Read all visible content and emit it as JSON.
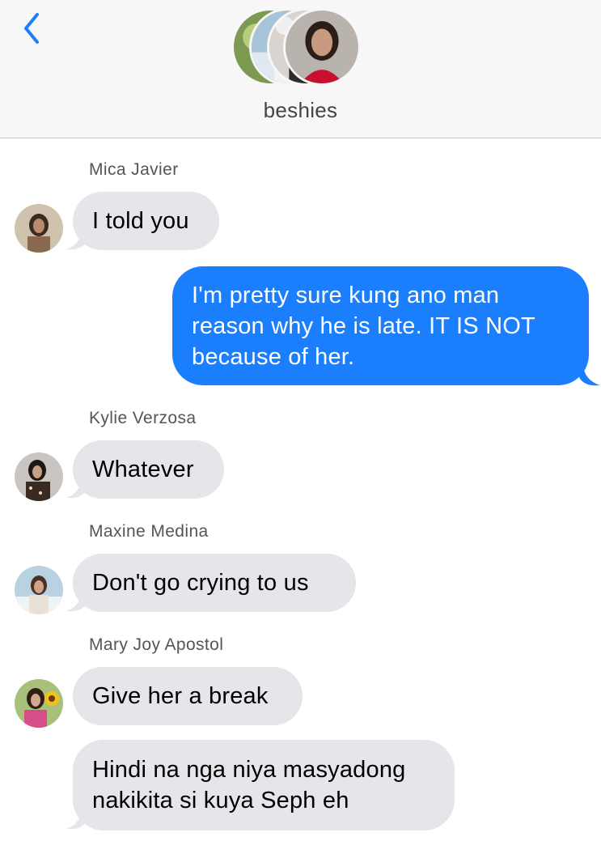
{
  "header": {
    "group_name": "beshies",
    "back_icon": "chevron-left-icon",
    "accent_color": "#1b7efc"
  },
  "messages": [
    {
      "sender": "Mica Javier",
      "text": "I told you",
      "direction": "incoming"
    },
    {
      "text": "I'm pretty sure kung ano man reason why he is late. IT IS NOT because of her.",
      "line1": "I'm pretty sure kung ano man",
      "line2": "reason why he is late. IT IS NOT",
      "line3": "because of her.",
      "direction": "outgoing"
    },
    {
      "sender": "Kylie Verzosa",
      "text": "Whatever",
      "direction": "incoming"
    },
    {
      "sender": "Maxine Medina",
      "text": "Don't go crying to us",
      "direction": "incoming"
    },
    {
      "sender": "Mary Joy Apostol",
      "text": "Give her a break",
      "direction": "incoming"
    },
    {
      "text": "Hindi na nga niya masyadong nakikita si kuya Seph eh",
      "line1": "Hindi na nga niya masyadong",
      "line2": "nakikita si kuya Seph eh",
      "direction": "incoming"
    }
  ]
}
